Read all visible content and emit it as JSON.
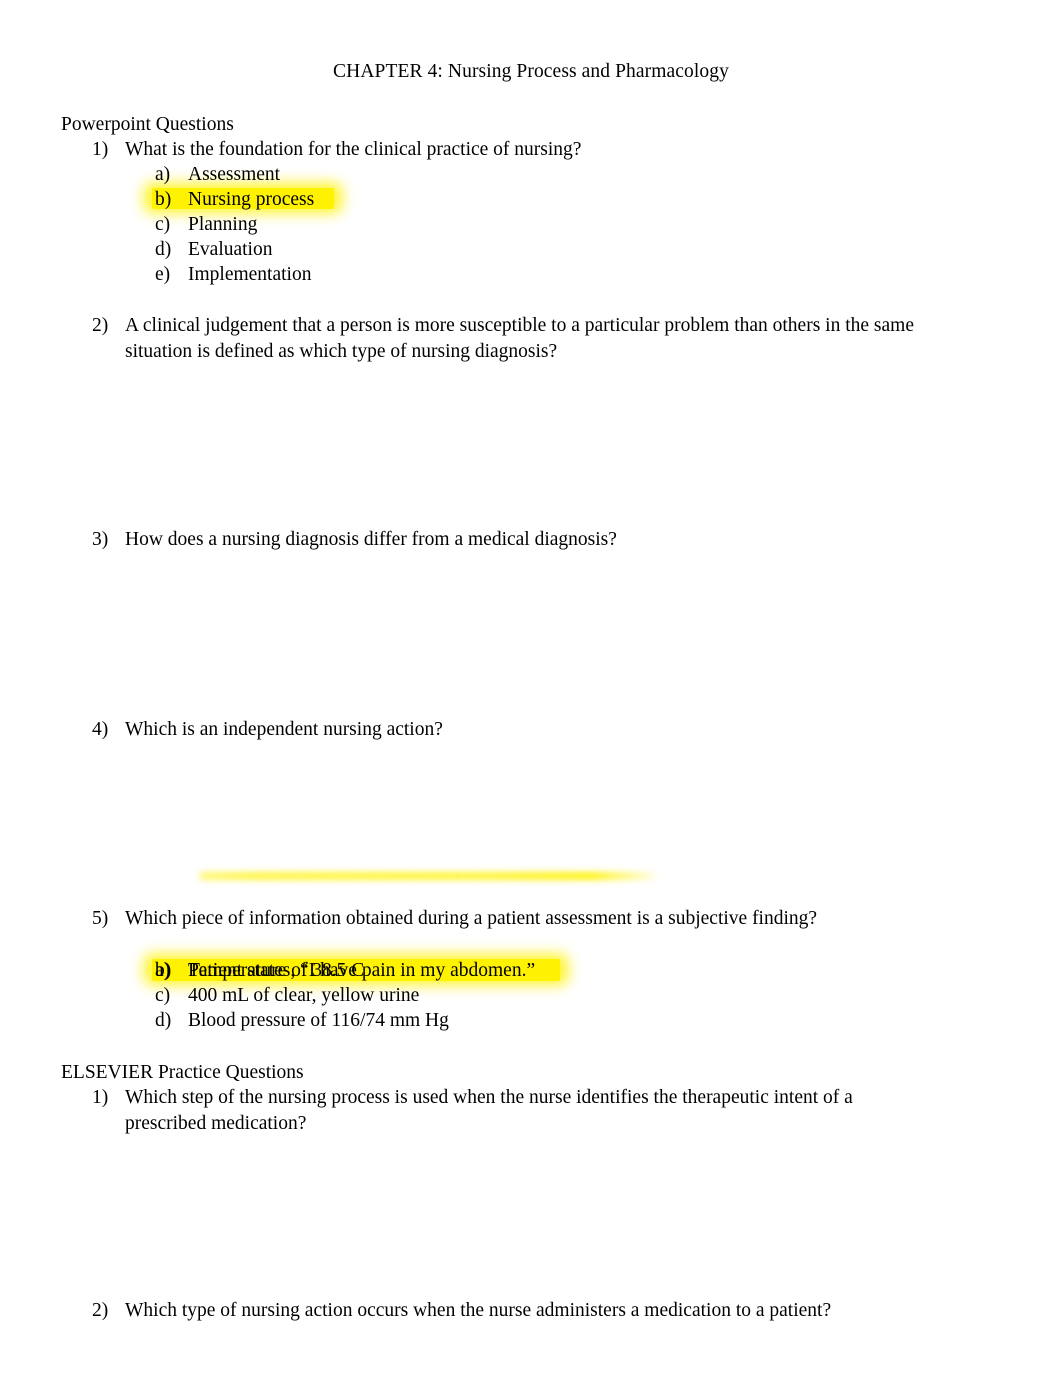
{
  "document": {
    "title": "CHAPTER 4: Nursing Process and Pharmacology",
    "highlight_color": "#fff200",
    "text_color": "#000000",
    "background_color": "#ffffff"
  },
  "sections": [
    {
      "heading": "Powerpoint Questions",
      "questions": [
        {
          "marker": "1)",
          "text": "What is the foundation for the clinical practice of nursing?",
          "options": [
            {
              "marker": "a)",
              "text": "Assessment",
              "highlighted": false
            },
            {
              "marker": "b)",
              "text": "Nursing process",
              "highlighted": true
            },
            {
              "marker": "c)",
              "text": "Planning",
              "highlighted": false
            },
            {
              "marker": "d)",
              "text": "Evaluation",
              "highlighted": false
            },
            {
              "marker": "e)",
              "text": "Implementation",
              "highlighted": false
            }
          ]
        },
        {
          "marker": "2)",
          "text": "A clinical judgement that a person is more susceptible to a particular problem than others in the same situation is defined as which type of nursing diagnosis?",
          "options": []
        },
        {
          "marker": "3)",
          "text": "How does a nursing diagnosis differ from a medical diagnosis?",
          "options": []
        },
        {
          "marker": "4)",
          "text": "Which is an independent nursing action?",
          "options": []
        },
        {
          "marker": "5)",
          "text": "Which piece of information obtained during a patient assessment is a subjective finding?",
          "options": [
            {
              "marker": "a)",
              "text": "Patient states, “I have pain in my abdomen.”",
              "highlighted": true
            },
            {
              "marker": "b)",
              "text": "Temperature of 38.5 C",
              "highlighted": false
            },
            {
              "marker": "c)",
              "text": "400 mL of clear, yellow urine",
              "highlighted": false
            },
            {
              "marker": "d)",
              "text": "Blood pressure of 116/74 mm Hg",
              "highlighted": false
            }
          ]
        }
      ]
    },
    {
      "heading": "ELSEVIER Practice Questions",
      "questions": [
        {
          "marker": "1)",
          "text": "Which step of the nursing process is used when the nurse identifies the therapeutic intent of a prescribed medication?",
          "options": []
        },
        {
          "marker": "2)",
          "text": "Which type of nursing action occurs when the nurse administers a medication to a patient?",
          "options": []
        }
      ]
    }
  ]
}
